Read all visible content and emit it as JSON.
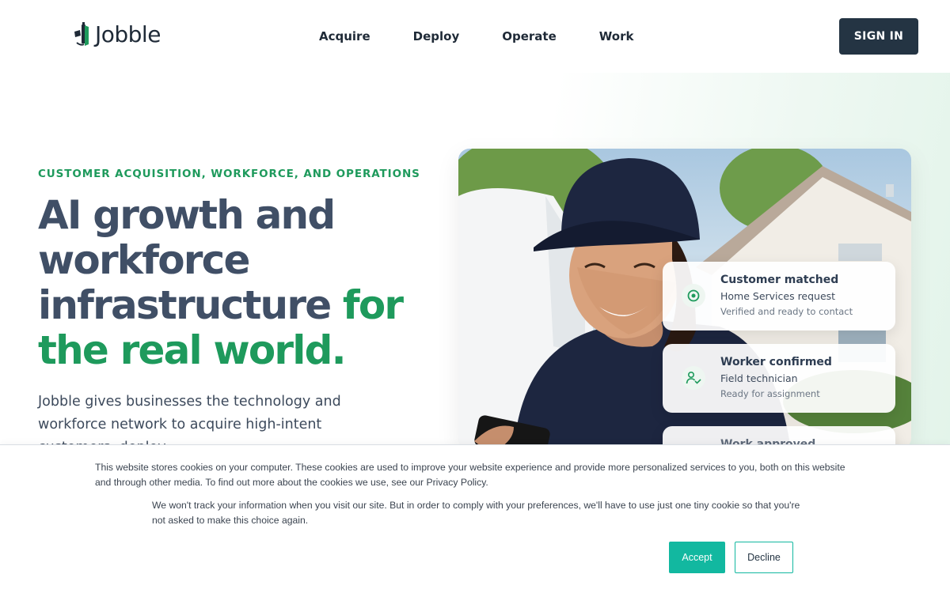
{
  "brand": {
    "name": "Jobble"
  },
  "nav": {
    "items": [
      {
        "label": "Acquire"
      },
      {
        "label": "Deploy"
      },
      {
        "label": "Operate"
      },
      {
        "label": "Work"
      }
    ],
    "signin_label": "SIGN IN"
  },
  "hero": {
    "eyebrow": "CUSTOMER ACQUISITION, WORKFORCE, AND OPERATIONS",
    "headline_main": "AI growth and workforce infrastructure ",
    "headline_accent": "for the real world.",
    "lede": "Jobble gives businesses the technology and workforce network to acquire high-intent customers, deploy"
  },
  "status_cards": [
    {
      "title": "Customer matched",
      "subtitle": "Home Services request",
      "detail": "Verified and ready to contact",
      "icon": "target-icon"
    },
    {
      "title": "Worker confirmed",
      "subtitle": "Field technician",
      "detail": "Ready for assignment",
      "icon": "user-check-icon"
    },
    {
      "title": "Work approved",
      "icon": "check-icon"
    }
  ],
  "cookie_banner": {
    "text1": "This website stores cookies on your computer. These cookies are used to improve your website experience and provide more personalized services to you, both on this website and through other media. To find out more about the cookies we use, see our Privacy Policy.",
    "text2": "We won't track your information when you visit our site. But in order to comply with your preferences, we'll have to use just one tiny cookie so that you're not asked to make this choice again.",
    "accept_label": "Accept",
    "decline_label": "Decline"
  },
  "colors": {
    "brand_green": "#1e9a5c",
    "heading": "#404f66",
    "signin_bg": "#243443",
    "cookie_accent": "#12b8a0"
  }
}
